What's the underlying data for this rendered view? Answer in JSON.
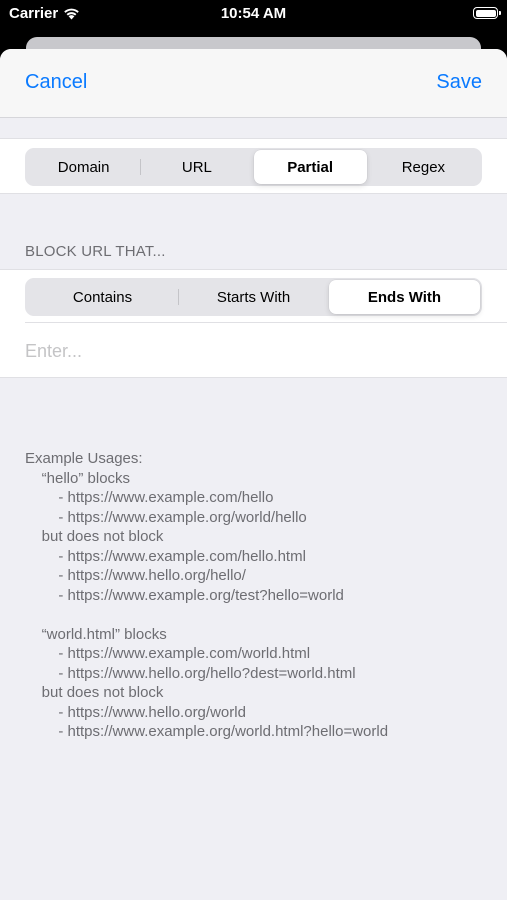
{
  "status_bar": {
    "carrier": "Carrier",
    "time": "10:54 AM"
  },
  "nav": {
    "cancel_label": "Cancel",
    "save_label": "Save",
    "accent_color": "#0a7aff"
  },
  "rule_type": {
    "options": [
      "Domain",
      "URL",
      "Partial",
      "Regex"
    ],
    "selected": "Partial"
  },
  "match_section": {
    "header": "BLOCK URL THAT...",
    "options": [
      "Contains",
      "Starts With",
      "Ends With"
    ],
    "selected": "Ends With"
  },
  "input": {
    "placeholder": "Enter...",
    "value": ""
  },
  "examples": {
    "lines": [
      "Example Usages:",
      "    “hello” blocks",
      "        - https://www.example.com/hello",
      "        - https://www.example.org/world/hello",
      "    but does not block",
      "        - https://www.example.com/hello.html",
      "        - https://www.hello.org/hello/",
      "        - https://www.example.org/test?hello=world",
      "",
      "    “world.html” blocks",
      "        - https://www.example.com/world.html",
      "        - https://www.hello.org/hello?dest=world.html",
      "    but does not block",
      "        - https://www.hello.org/world",
      "        - https://www.example.org/world.html?hello=world"
    ]
  }
}
